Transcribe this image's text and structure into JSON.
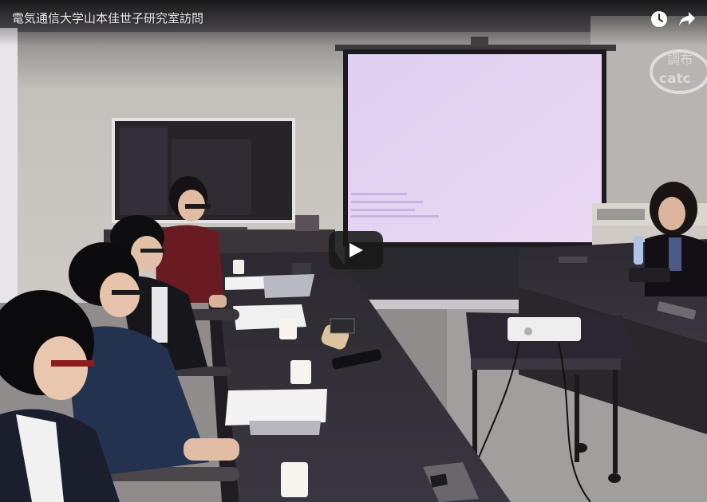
{
  "video": {
    "title": "電気通信大学山本佳世子研究室訪問",
    "watermark_line1": "調布",
    "watermark_line2": "catc"
  },
  "controls": {
    "watch_later_icon": "clock-icon",
    "share_icon": "share-arrow-icon",
    "play_icon": "play-icon"
  },
  "colors": {
    "screen": "#e4d5f2",
    "tables": "#332f37",
    "room_wall": "#cdc9c4",
    "ceiling": "#7d7b7e"
  }
}
